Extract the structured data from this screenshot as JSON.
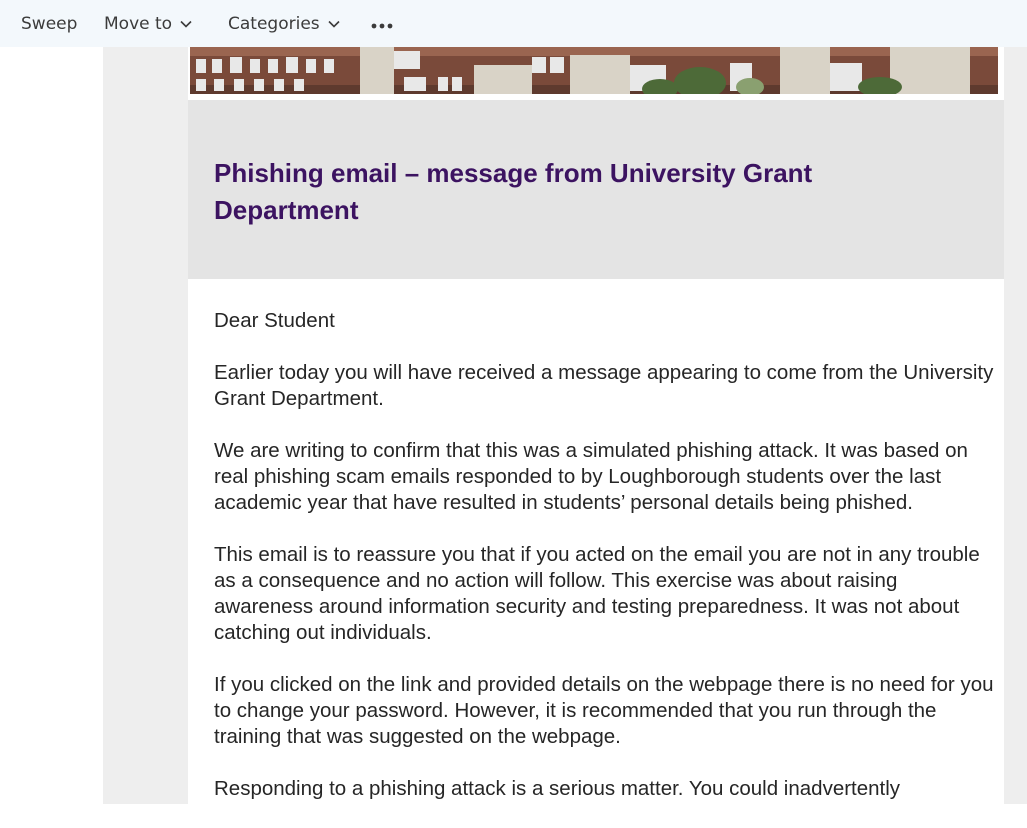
{
  "toolbar": {
    "sweep_label": "Sweep",
    "move_to_label": "Move to",
    "categories_label": "Categories",
    "more_label": "•••"
  },
  "email": {
    "title": "Phishing email – message from University Grant Department",
    "greeting": "Dear Student",
    "paragraphs": [
      "Earlier today you will have received a message appearing to come from the University Grant Department.",
      "We are writing to confirm that this was a simulated phishing attack. It was based on real phishing scam emails responded to by Loughborough students over the last academic year that have resulted in students’ personal details being phished.",
      "This email is to reassure you that if you acted on the email you are not in any trouble as a consequence and no action will follow. This exercise was about raising awareness around information security and testing preparedness. It was not about catching out individuals.",
      "If you clicked on the link and provided details on the webpage there is no need for you to change your password. However, it is recommended that you run through the training that was suggested on the webpage.",
      "Responding to a phishing attack is a serious matter. You could inadvertently"
    ]
  },
  "colors": {
    "title": "#3c1361",
    "toolbar_bg": "#f3f8fc",
    "title_box_bg": "#e4e4e4",
    "pane_bg": "#eeeeee"
  },
  "icons": [
    "chevron-down-icon",
    "more-options-icon",
    "building-banner-image"
  ]
}
